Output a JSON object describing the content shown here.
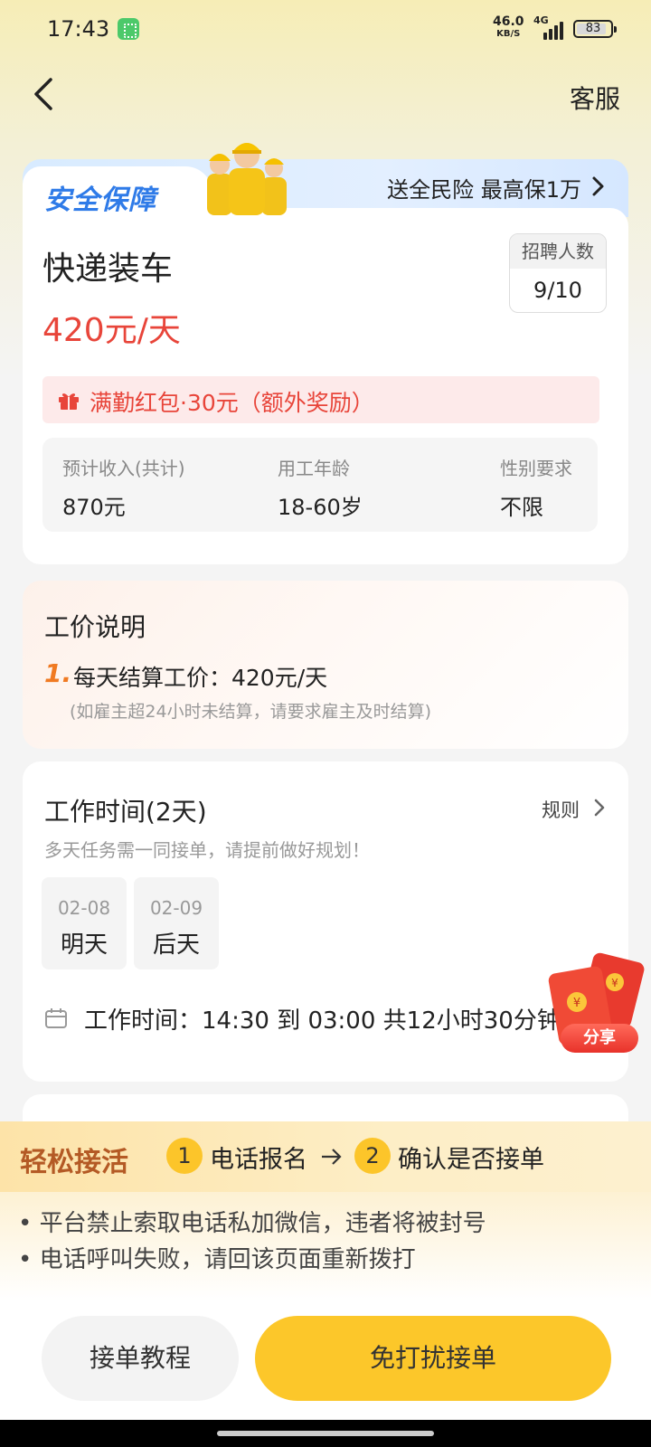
{
  "status_bar": {
    "time": "17:43",
    "speed_value": "46.0",
    "speed_unit": "KB/S",
    "network": "4G",
    "battery": "83"
  },
  "nav": {
    "customer_service": "客服"
  },
  "safety": {
    "title": "安全保障",
    "promo": "送全民险 最高保1万"
  },
  "job": {
    "title": "快递装车",
    "wage": "420元/天",
    "recruit_label": "招聘人数",
    "recruit_value": "9/10",
    "bonus": "满勤红包·30元（额外奖励）",
    "stats": [
      {
        "label": "预计收入(共计)",
        "value": "870元"
      },
      {
        "label": "用工年龄",
        "value": "18-60岁"
      },
      {
        "label": "性别要求",
        "value": "不限"
      }
    ]
  },
  "pricing": {
    "title": "工价说明",
    "item_number": "1.",
    "item_text": "每天结算工价：420元/天",
    "note": "(如雇主超24小时未结算，请要求雇主及时结算)"
  },
  "work_time": {
    "title": "工作时间(2天)",
    "rules_label": "规则",
    "subtitle": "多天任务需一同接单，请提前做好规划！",
    "dates": [
      {
        "date": "02-08",
        "day": "明天"
      },
      {
        "date": "02-09",
        "day": "后天"
      }
    ],
    "time_range": "工作时间：14:30 到 03:00 共12小时30分钟"
  },
  "share": {
    "label": "分享"
  },
  "flow": {
    "title": "轻松接活",
    "steps": [
      {
        "num": "1",
        "text": "电话报名"
      },
      {
        "num": "2",
        "text": "确认是否接单"
      }
    ]
  },
  "notices": [
    "• 平台禁止索取电话私加微信，违者将被封号",
    "• 电话呼叫失败，请回该页面重新拨打"
  ],
  "buttons": {
    "tutorial": "接单教程",
    "accept": "免打扰接单"
  },
  "colors": {
    "accent_yellow": "#fcc72a",
    "price_red": "#e8453a",
    "safety_blue": "#2f7be8"
  }
}
